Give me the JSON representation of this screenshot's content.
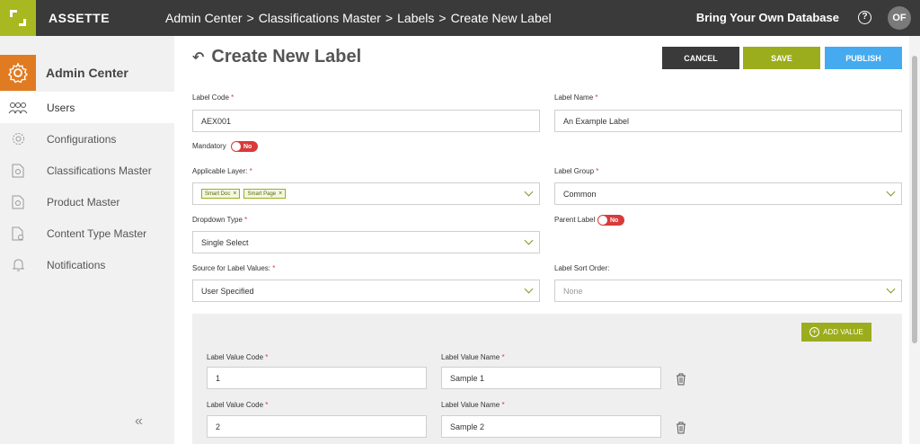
{
  "header": {
    "brand": "ASSETTE",
    "breadcrumbs": [
      "Admin Center",
      "Classifications Master",
      "Labels",
      "Create New Label"
    ],
    "separator": ">",
    "byod": "Bring Your Own Database",
    "help": "?",
    "avatar": "OF"
  },
  "sidebar": {
    "title": "Admin Center",
    "items": [
      {
        "label": "Users",
        "icon": "users-icon"
      },
      {
        "label": "Configurations",
        "icon": "gear-icon"
      },
      {
        "label": "Classifications Master",
        "icon": "document-icon"
      },
      {
        "label": "Product Master",
        "icon": "document-icon"
      },
      {
        "label": "Content Type Master",
        "icon": "file-icon"
      },
      {
        "label": "Notifications",
        "icon": "bell-icon"
      }
    ],
    "collapse": "«"
  },
  "page": {
    "title": "Create New Label",
    "back_icon": "↶",
    "cancel": "CANCEL",
    "save": "SAVE",
    "publish": "PUBLISH"
  },
  "form": {
    "label_code": {
      "label": "Label Code",
      "value": "AEX001"
    },
    "label_name": {
      "label": "Label Name",
      "value": "An Example Label"
    },
    "mandatory": {
      "label": "Mandatory",
      "state": "No"
    },
    "applicable_layer": {
      "label": "Applicable Layer:",
      "chips": [
        "Smart Doc",
        "Smart Page"
      ]
    },
    "label_group": {
      "label": "Label Group",
      "value": "Common"
    },
    "dropdown_type": {
      "label": "Dropdown Type",
      "value": "Single Select"
    },
    "parent_label": {
      "label": "Parent Label",
      "state": "No"
    },
    "source": {
      "label": "Source for Label Values:",
      "value": "User Specified"
    },
    "sort_order": {
      "label": "Label Sort Order:",
      "value": "None"
    },
    "required_mark": "*"
  },
  "values": {
    "add_label": "ADD VALUE",
    "code_label": "Label Value Code",
    "name_label": "Label Value Name",
    "rows": [
      {
        "code": "1",
        "name": "Sample 1"
      },
      {
        "code": "2",
        "name": "Sample 2"
      }
    ]
  },
  "colors": {
    "accent_green": "#9bad1c",
    "accent_orange": "#e07b22",
    "publish_blue": "#45aaf0",
    "toggle_red": "#d93a3a"
  }
}
